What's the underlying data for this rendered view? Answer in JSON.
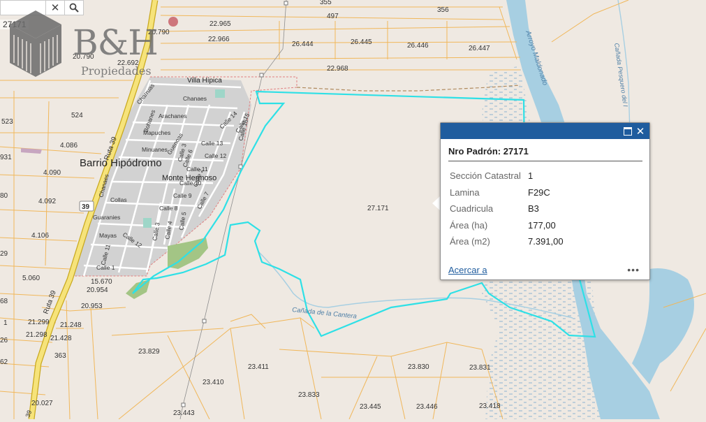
{
  "search": {
    "clear_glyph": "✕",
    "search_glyph": "🔍",
    "coordinate": "27171"
  },
  "logo": {
    "name": "B&H",
    "subtitle": "Propiedades"
  },
  "map": {
    "place_names": {
      "barrio": "Barrio Hipódromo",
      "monte": "Monte Hermoso",
      "villa": "Villa Hípica"
    },
    "streets": [
      "Chanaes",
      "Arachanes",
      "Mapuches",
      "Minuanes",
      "Guenoas",
      "Guaranies",
      "Mayas",
      "Collas",
      "Bohanes",
      "Charruas",
      "Chanaes",
      "Calle 14",
      "Calle 15",
      "Calle 13",
      "Calle 12",
      "Calle 11",
      "Calle 10",
      "Calle 9",
      "Calle 8",
      "Calle 7",
      "Calle 6",
      "Calle 5",
      "Calle 4",
      "Calle 3",
      "Calle 2",
      "Calle 1",
      "Calle 12",
      "Calle 11",
      "Calle 16",
      "Calle 3"
    ],
    "routes": {
      "ruta39_a": "Ruta 39",
      "ruta39_b": "Ruta 39",
      "ruta39_c": "39",
      "shield": "39"
    },
    "water": {
      "arroyo": "Arroyo Maldonado",
      "canada_cantera": "Cañada de la Cantera",
      "canada_pesquero": "Cañada Pesquero del I"
    },
    "parcels": [
      "355",
      "497",
      "356",
      "22.965",
      "22.966",
      "26.444",
      "26.445",
      "26.446",
      "26.447",
      "22.968",
      "20.790",
      "20.790",
      "22.692",
      "524",
      "4.086",
      "4.090",
      "4.092",
      "4.106",
      "5.060",
      "15.670",
      "20.954",
      "20.953",
      "21.299",
      "21.248",
      "21.298",
      "21.428",
      "363",
      "20.027",
      "27.171",
      "23.829",
      "23.411",
      "23.410",
      "23.443",
      "23.833",
      "23.830",
      "23.831",
      "23.445",
      "23.446",
      "23.418",
      "523",
      "931",
      "80",
      "29",
      "68",
      "1",
      "26",
      "62"
    ],
    "colors": {
      "background": "#efe9e2",
      "parcel_line": "#f0b75a",
      "road": "#e8c850",
      "river": "#a7cfe2",
      "selection": "#2ee0e6",
      "urban": "#d2d2d2",
      "park": "#a3c585"
    }
  },
  "popup": {
    "title": "Nro Padrón: 27171",
    "attributes": [
      {
        "name": "Sección Catastral",
        "value": "1"
      },
      {
        "name": "Lamina",
        "value": "F29C"
      },
      {
        "name": "Cuadricula",
        "value": "B3"
      },
      {
        "name": "Área (ha)",
        "value": "177,00"
      },
      {
        "name": "Área (m2)",
        "value": "7.391,00"
      }
    ],
    "zoom_link": "Acercar a",
    "more": "•••",
    "close_glyph": "✕",
    "header_color": "#1f5c9e"
  }
}
